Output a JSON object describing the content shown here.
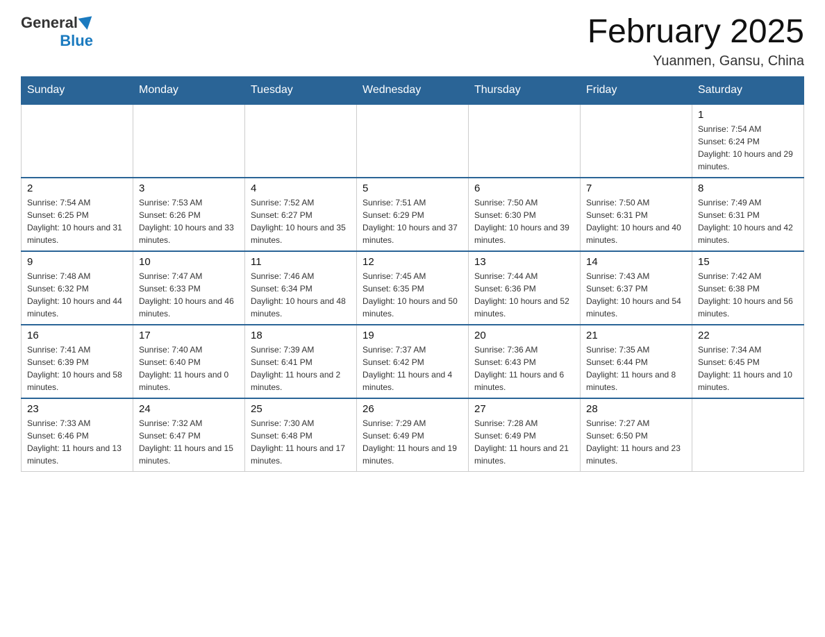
{
  "header": {
    "logo_general": "General",
    "logo_blue": "Blue",
    "title": "February 2025",
    "subtitle": "Yuanmen, Gansu, China"
  },
  "days_of_week": [
    "Sunday",
    "Monday",
    "Tuesday",
    "Wednesday",
    "Thursday",
    "Friday",
    "Saturday"
  ],
  "weeks": [
    [
      {
        "day": "",
        "info": ""
      },
      {
        "day": "",
        "info": ""
      },
      {
        "day": "",
        "info": ""
      },
      {
        "day": "",
        "info": ""
      },
      {
        "day": "",
        "info": ""
      },
      {
        "day": "",
        "info": ""
      },
      {
        "day": "1",
        "info": "Sunrise: 7:54 AM\nSunset: 6:24 PM\nDaylight: 10 hours and 29 minutes."
      }
    ],
    [
      {
        "day": "2",
        "info": "Sunrise: 7:54 AM\nSunset: 6:25 PM\nDaylight: 10 hours and 31 minutes."
      },
      {
        "day": "3",
        "info": "Sunrise: 7:53 AM\nSunset: 6:26 PM\nDaylight: 10 hours and 33 minutes."
      },
      {
        "day": "4",
        "info": "Sunrise: 7:52 AM\nSunset: 6:27 PM\nDaylight: 10 hours and 35 minutes."
      },
      {
        "day": "5",
        "info": "Sunrise: 7:51 AM\nSunset: 6:29 PM\nDaylight: 10 hours and 37 minutes."
      },
      {
        "day": "6",
        "info": "Sunrise: 7:50 AM\nSunset: 6:30 PM\nDaylight: 10 hours and 39 minutes."
      },
      {
        "day": "7",
        "info": "Sunrise: 7:50 AM\nSunset: 6:31 PM\nDaylight: 10 hours and 40 minutes."
      },
      {
        "day": "8",
        "info": "Sunrise: 7:49 AM\nSunset: 6:31 PM\nDaylight: 10 hours and 42 minutes."
      }
    ],
    [
      {
        "day": "9",
        "info": "Sunrise: 7:48 AM\nSunset: 6:32 PM\nDaylight: 10 hours and 44 minutes."
      },
      {
        "day": "10",
        "info": "Sunrise: 7:47 AM\nSunset: 6:33 PM\nDaylight: 10 hours and 46 minutes."
      },
      {
        "day": "11",
        "info": "Sunrise: 7:46 AM\nSunset: 6:34 PM\nDaylight: 10 hours and 48 minutes."
      },
      {
        "day": "12",
        "info": "Sunrise: 7:45 AM\nSunset: 6:35 PM\nDaylight: 10 hours and 50 minutes."
      },
      {
        "day": "13",
        "info": "Sunrise: 7:44 AM\nSunset: 6:36 PM\nDaylight: 10 hours and 52 minutes."
      },
      {
        "day": "14",
        "info": "Sunrise: 7:43 AM\nSunset: 6:37 PM\nDaylight: 10 hours and 54 minutes."
      },
      {
        "day": "15",
        "info": "Sunrise: 7:42 AM\nSunset: 6:38 PM\nDaylight: 10 hours and 56 minutes."
      }
    ],
    [
      {
        "day": "16",
        "info": "Sunrise: 7:41 AM\nSunset: 6:39 PM\nDaylight: 10 hours and 58 minutes."
      },
      {
        "day": "17",
        "info": "Sunrise: 7:40 AM\nSunset: 6:40 PM\nDaylight: 11 hours and 0 minutes."
      },
      {
        "day": "18",
        "info": "Sunrise: 7:39 AM\nSunset: 6:41 PM\nDaylight: 11 hours and 2 minutes."
      },
      {
        "day": "19",
        "info": "Sunrise: 7:37 AM\nSunset: 6:42 PM\nDaylight: 11 hours and 4 minutes."
      },
      {
        "day": "20",
        "info": "Sunrise: 7:36 AM\nSunset: 6:43 PM\nDaylight: 11 hours and 6 minutes."
      },
      {
        "day": "21",
        "info": "Sunrise: 7:35 AM\nSunset: 6:44 PM\nDaylight: 11 hours and 8 minutes."
      },
      {
        "day": "22",
        "info": "Sunrise: 7:34 AM\nSunset: 6:45 PM\nDaylight: 11 hours and 10 minutes."
      }
    ],
    [
      {
        "day": "23",
        "info": "Sunrise: 7:33 AM\nSunset: 6:46 PM\nDaylight: 11 hours and 13 minutes."
      },
      {
        "day": "24",
        "info": "Sunrise: 7:32 AM\nSunset: 6:47 PM\nDaylight: 11 hours and 15 minutes."
      },
      {
        "day": "25",
        "info": "Sunrise: 7:30 AM\nSunset: 6:48 PM\nDaylight: 11 hours and 17 minutes."
      },
      {
        "day": "26",
        "info": "Sunrise: 7:29 AM\nSunset: 6:49 PM\nDaylight: 11 hours and 19 minutes."
      },
      {
        "day": "27",
        "info": "Sunrise: 7:28 AM\nSunset: 6:49 PM\nDaylight: 11 hours and 21 minutes."
      },
      {
        "day": "28",
        "info": "Sunrise: 7:27 AM\nSunset: 6:50 PM\nDaylight: 11 hours and 23 minutes."
      },
      {
        "day": "",
        "info": ""
      }
    ]
  ]
}
